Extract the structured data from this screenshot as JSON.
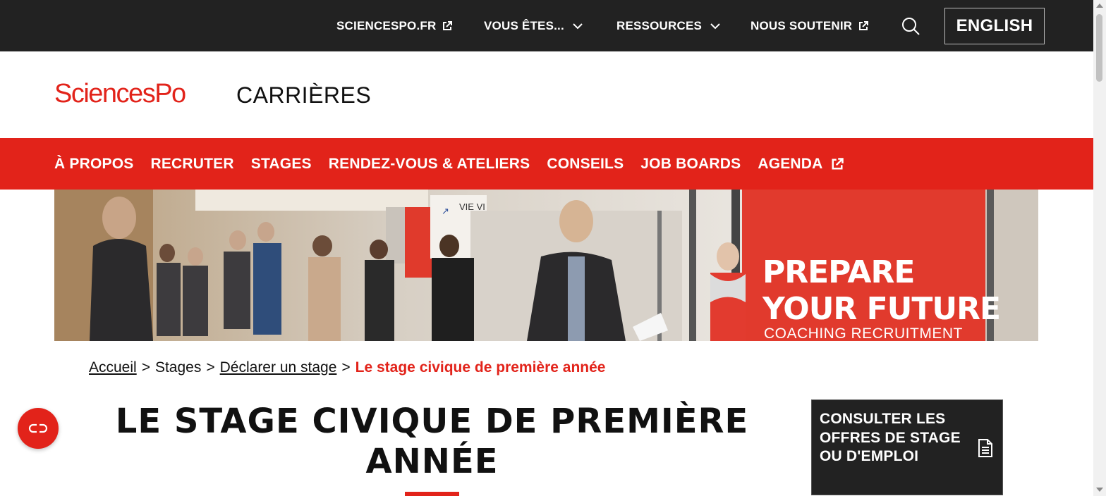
{
  "topbar": {
    "items": [
      {
        "label": "SCIENCESPO.FR",
        "icon": "external-link-icon"
      },
      {
        "label": "VOUS ÊTES...",
        "icon": "chevron-down-icon"
      },
      {
        "label": "RESSOURCES",
        "icon": "chevron-down-icon"
      },
      {
        "label": "NOUS SOUTENIR",
        "icon": "external-link-icon"
      }
    ],
    "search_icon": "search-icon",
    "language_label": "ENGLISH"
  },
  "header": {
    "logo_text": "SciencesPo",
    "section_title": "CARRIÈRES"
  },
  "main_nav": {
    "items": [
      {
        "label": "À PROPOS"
      },
      {
        "label": "RECRUTER"
      },
      {
        "label": "STAGES"
      },
      {
        "label": "RENDEZ-VOUS & ATELIERS"
      },
      {
        "label": "CONSEILS"
      },
      {
        "label": "JOB BOARDS"
      },
      {
        "label": "AGENDA",
        "icon": "external-link-icon"
      }
    ]
  },
  "banner": {
    "headline_line1": "PREPARE",
    "headline_line2": "YOUR FUTURE",
    "subline": "COACHING RECRUITMENT",
    "stand_label": "VIE VI"
  },
  "breadcrumb": {
    "items": [
      "Accueil",
      "Stages",
      "Déclarer un stage"
    ],
    "current": "Le stage civique de première année",
    "separator": ">"
  },
  "page": {
    "title": "LE STAGE CIVIQUE DE PREMIÈRE ANNÉE"
  },
  "cta": {
    "label": "CONSULTER LES OFFRES DE STAGE OU D'EMPLOI",
    "icon": "document-icon"
  },
  "chat": {
    "icon": "chat-icon"
  },
  "colors": {
    "brand_red": "#e2231a",
    "dark": "#222222",
    "white": "#ffffff"
  }
}
